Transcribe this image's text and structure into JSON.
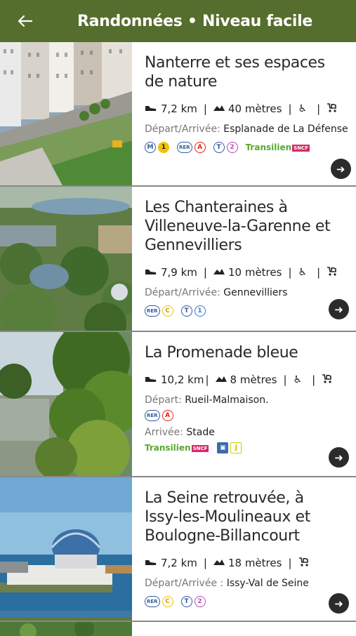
{
  "header": {
    "back_icon": "arrow-left-icon",
    "title": "Randonnées • Niveau facile"
  },
  "colors": {
    "appbar": "#556e2d",
    "arrow_button": "#2b2b2b"
  },
  "hikes": [
    {
      "title_l1": "Nanterre et ses espaces",
      "title_l2": "de nature",
      "distance": "7,2 km",
      "elevation": "40 mètres",
      "depart_label": "Départ/Arrivée:",
      "depart_value": "Esplanade de La Défense",
      "transports": [
        "M",
        "1",
        "RER",
        "A",
        "T",
        "2"
      ],
      "transilien": "Transilien"
    },
    {
      "title_l1": "Les Chanteraines à",
      "title_l2": "Villeneuve-la-Garenne et",
      "title_l3": "Gennevilliers",
      "distance": "7,9 km",
      "elevation": "10 mètres",
      "depart_label": "Départ/Arrivée:",
      "depart_value": "Gennevilliers",
      "transports": [
        "RER",
        "C",
        "T",
        "1"
      ]
    },
    {
      "title_l1": "La Promenade bleue",
      "distance": "10,2 km",
      "elevation": "8 mètres",
      "depart_label": "Départ:",
      "depart_value": "Rueil-Malmaison.",
      "arrivee_label": "Arrivée:",
      "arrivee_value": "Stade",
      "transports": [
        "RER",
        "A",
        "J"
      ],
      "transilien": "Transilien"
    },
    {
      "title_l1": "La Seine retrouvée, à",
      "title_l2": "Issy-les-Moulineaux et",
      "title_l3": "Boulogne-Billancourt",
      "distance": "7,2  km",
      "elevation": "18 mètres",
      "depart_label": "Départ/Arrivée :",
      "depart_value": "Issy-Val de Seine",
      "transports": [
        "RER",
        "C",
        "T",
        "2"
      ]
    }
  ],
  "icons": {
    "shoe": "shoe-icon",
    "elevation": "elevation-icon",
    "wheelchair": "wheelchair-icon",
    "stroller": "stroller-icon",
    "go": "arrow-right-circle-icon"
  }
}
